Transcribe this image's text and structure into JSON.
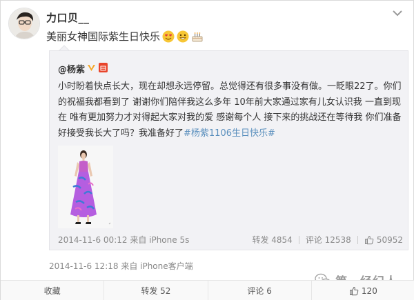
{
  "post": {
    "username": "力口贝__",
    "text": "美丽女神国际紫生日快乐",
    "emojis": [
      "heart-eyes-emoji",
      "grin-emoji",
      "cake-emoji"
    ],
    "timestamp": "2014-11-6 12:18 来自 iPhone客户端"
  },
  "retweet": {
    "author": "@杨紫",
    "text": "小时盼着快点长大，现在却想永远停留。总觉得还有很多事没有做。一眨眼22了。你们的祝福我都看到了 谢谢你们陪伴我这么多年 10年前大家通过家有儿女认识我 一直到现在 唯有更加努力才对得起大家对我的爱 感谢每个人 接下来的挑战还在等待我 你们准备好接受我长大了吗？我准备好了",
    "hashtag": "#杨紫1106生日快乐#",
    "timestamp": "2014-11-6 00:12 来自 iPhone 5s",
    "reposts": "转发 4854",
    "comments": "评论 12538",
    "likes": "50952"
  },
  "actions": {
    "favorite": "收藏",
    "repost": "转发 52",
    "comment": "评论 6",
    "like": "120"
  },
  "watermark": {
    "text": "第一经纪人"
  },
  "colors": {
    "link": "#5a8fbd",
    "meta": "#888888",
    "retweet_bg": "#f2f2f5",
    "badge_red": "#e8442b",
    "verified_gold": "#f5a623"
  }
}
